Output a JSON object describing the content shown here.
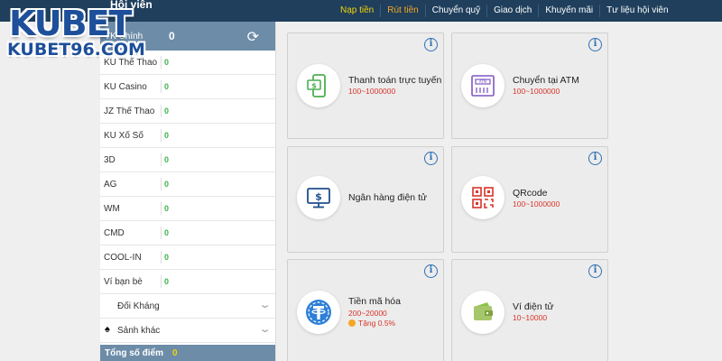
{
  "header": {
    "member_title": "Hội viên",
    "nav": [
      {
        "label": "Nạp tiền",
        "active": true
      },
      {
        "label": "Rút tiền",
        "highlight": true
      },
      {
        "label": "Chuyển quỹ"
      },
      {
        "label": "Giao dịch"
      },
      {
        "label": "Khuyến mãi"
      },
      {
        "label": "Tư liệu hội viên"
      }
    ]
  },
  "logo": {
    "main": "KUBET",
    "sub": "KUBET96.COM"
  },
  "sidebar": {
    "head": {
      "label": "TK Chính",
      "value": "0",
      "icon": "refresh-icon"
    },
    "rows": [
      {
        "label": "KU Thể Thao",
        "value": "0"
      },
      {
        "label": "KU Casino",
        "value": "0"
      },
      {
        "label": "JZ Thể Thao",
        "value": "0"
      },
      {
        "label": "KU Xổ Số",
        "value": "0"
      },
      {
        "label": "3D",
        "value": "0"
      },
      {
        "label": "AG",
        "value": "0"
      },
      {
        "label": "WM",
        "value": "0"
      },
      {
        "label": "CMD",
        "value": "0"
      },
      {
        "label": "COOL-IN",
        "value": "0"
      },
      {
        "label": "Ví bạn bè",
        "value": "0"
      }
    ],
    "groups": [
      {
        "label": "Đối Kháng",
        "icon": "chevron-down-icon"
      },
      {
        "label": "Sảnh khác",
        "icon": "spade-icon"
      }
    ],
    "total": {
      "label": "Tổng số điểm",
      "value": "0"
    }
  },
  "cards": [
    {
      "title": "Thanh toán trực tuyến",
      "range": "100~1000000",
      "icon": "mobile-payment-icon"
    },
    {
      "title": "Chuyển tại ATM",
      "range": "100~1000000",
      "icon": "atm-icon"
    },
    {
      "title": "Ngân hàng điện tử",
      "range": "",
      "icon": "online-banking-icon"
    },
    {
      "title": "QRcode",
      "range": "100~1000000",
      "icon": "qrcode-icon"
    },
    {
      "title": "Tiền mã hóa",
      "range": "200~20000",
      "bonus": "Tặng 0.5%",
      "icon": "tether-icon"
    },
    {
      "title": "Ví điện tử",
      "range": "10~10000",
      "icon": "e-wallet-icon"
    }
  ],
  "colors": {
    "topbar": "#1f3f5c",
    "sidebar_head": "#6d8ca8",
    "value_green": "#3bb54a",
    "accent_red": "#d9342b",
    "info_blue": "#2d6fb5"
  }
}
